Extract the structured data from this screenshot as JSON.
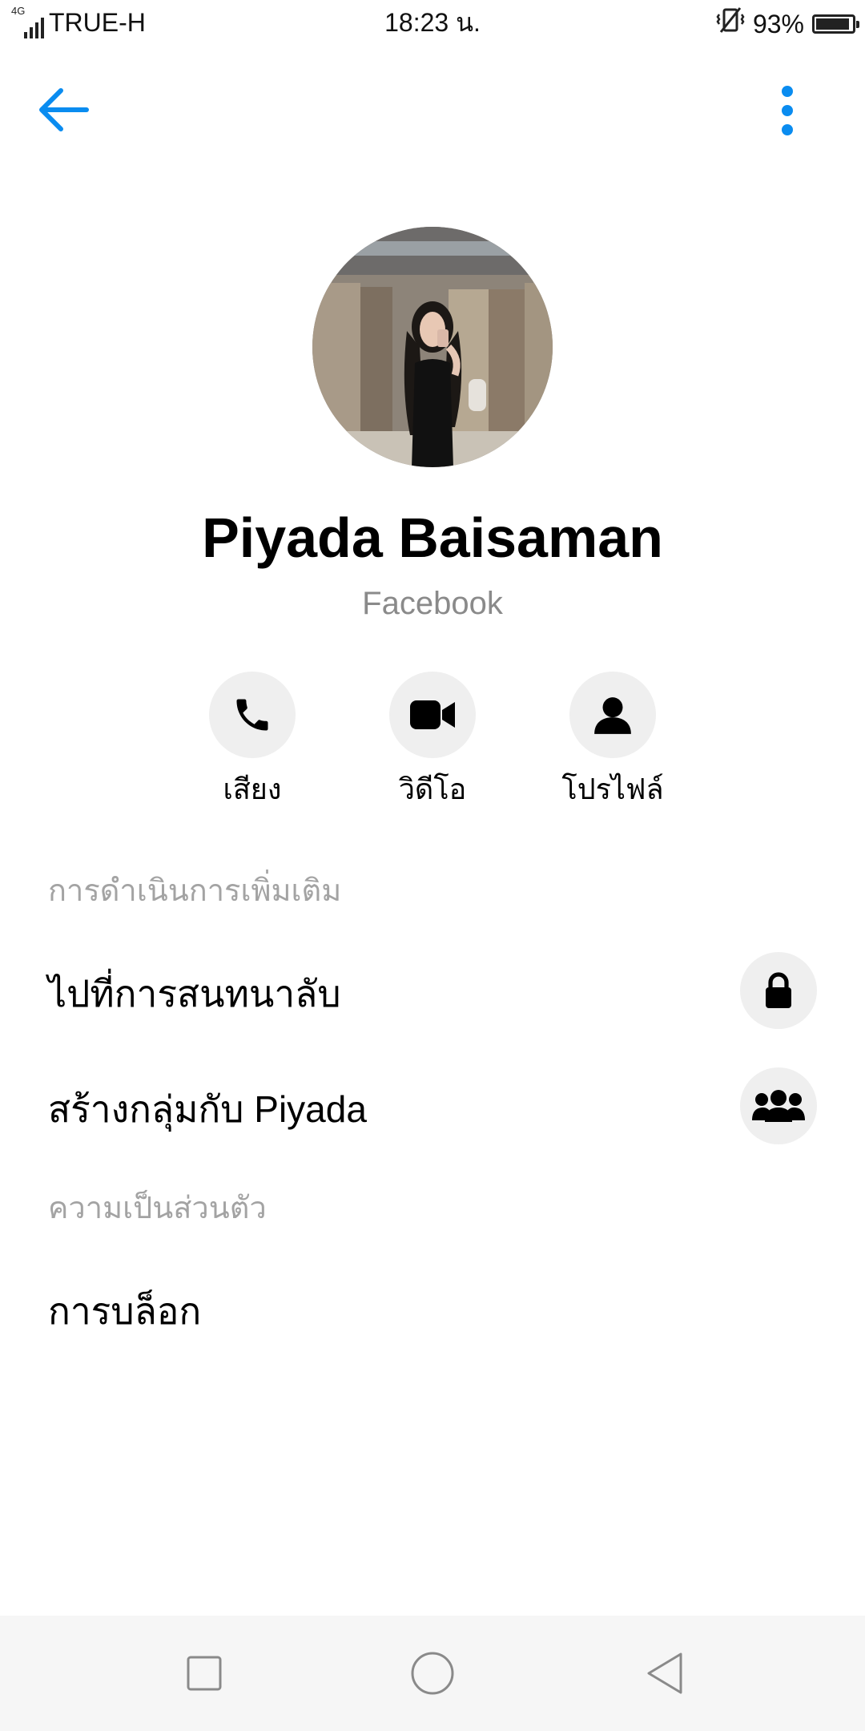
{
  "status_bar": {
    "network_type": "4G",
    "carrier": "TRUE-H",
    "time": "18:23 น.",
    "battery_percent": "93%",
    "battery_level": 0.93,
    "icons": [
      "signal-icon",
      "vibrate-icon",
      "battery-icon"
    ]
  },
  "top_bar": {
    "back_icon": "arrow-left-icon",
    "menu_icon": "more-vertical-icon",
    "accent_color": "#0a8cf0"
  },
  "profile": {
    "name": "Piyada Baisaman",
    "source": "Facebook"
  },
  "actions": [
    {
      "label": "เสียง",
      "icon": "phone-icon"
    },
    {
      "label": "วิดีโอ",
      "icon": "video-camera-icon"
    },
    {
      "label": "โปรไฟล์",
      "icon": "person-icon"
    }
  ],
  "sections": {
    "more_actions": {
      "header": "การดำเนินการเพิ่มเติม",
      "items": [
        {
          "label": "ไปที่การสนทนาลับ",
          "icon": "lock-icon"
        },
        {
          "label": "สร้างกลุ่มกับ Piyada",
          "icon": "group-icon"
        }
      ]
    },
    "privacy": {
      "header": "ความเป็นส่วนตัว",
      "items": [
        {
          "label": "การบล็อก"
        }
      ]
    }
  },
  "nav_bar": {
    "buttons": [
      "recents-square-icon",
      "home-circle-icon",
      "back-triangle-icon"
    ]
  }
}
